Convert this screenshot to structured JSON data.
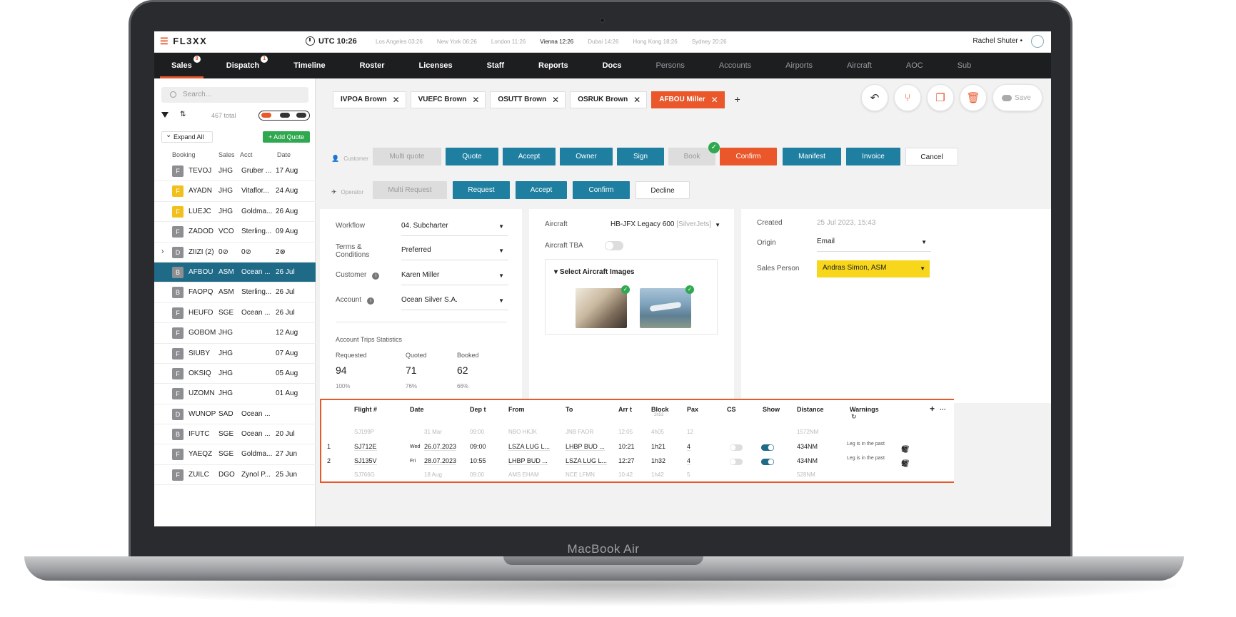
{
  "device": {
    "brand": "MacBook Air"
  },
  "topbar": {
    "logo": "FL3XX",
    "utc": "UTC 10:26",
    "cities": [
      "Los Angeles 03:26",
      "New York 06:26",
      "London 11:26",
      "Vienna 12:26",
      "Dubai 14:26",
      "Hong Kong 18:26",
      "Sydney 20:26"
    ],
    "active_city_index": 3,
    "user": "Rachel Shuter •"
  },
  "nav": {
    "items": [
      {
        "label": "Sales",
        "badge": "8",
        "active": true,
        "dim": false
      },
      {
        "label": "Dispatch",
        "badge": "1",
        "active": false,
        "dim": false
      },
      {
        "label": "Timeline",
        "badge": "",
        "active": false,
        "dim": false
      },
      {
        "label": "Roster",
        "badge": "",
        "active": false,
        "dim": false
      },
      {
        "label": "Licenses",
        "badge": "",
        "active": false,
        "dim": false
      },
      {
        "label": "Staff",
        "badge": "",
        "active": false,
        "dim": false
      },
      {
        "label": "Reports",
        "badge": "",
        "active": false,
        "dim": false
      },
      {
        "label": "Docs",
        "badge": "",
        "active": false,
        "dim": false
      },
      {
        "label": "Persons",
        "badge": "",
        "active": false,
        "dim": true
      },
      {
        "label": "Accounts",
        "badge": "",
        "active": false,
        "dim": true
      },
      {
        "label": "Airports",
        "badge": "",
        "active": false,
        "dim": true
      },
      {
        "label": "Aircraft",
        "badge": "",
        "active": false,
        "dim": true
      },
      {
        "label": "AOC",
        "badge": "",
        "active": false,
        "dim": true
      },
      {
        "label": "Sub",
        "badge": "",
        "active": false,
        "dim": true
      }
    ]
  },
  "sidebar": {
    "search_placeholder": "Search...",
    "total": "467 total",
    "expand_all": "Expand All",
    "add_quote": "+ Add Quote",
    "columns": [
      "Booking",
      "Sales",
      "Acct",
      "Date"
    ],
    "rows": [
      {
        "status": "F",
        "booking": "TEVOJ",
        "sales": "JHG",
        "acct": "Gruber ...",
        "date": "17 Aug",
        "yellow": false,
        "selected": false
      },
      {
        "status": "F",
        "booking": "AYADN",
        "sales": "JHG",
        "acct": "Vitaflor...",
        "date": "24 Aug",
        "yellow": true,
        "selected": false
      },
      {
        "status": "F",
        "booking": "LUEJC",
        "sales": "JHG",
        "acct": "Goldma...",
        "date": "26 Aug",
        "yellow": true,
        "selected": false
      },
      {
        "status": "F",
        "booking": "ZADOD",
        "sales": "VCO",
        "acct": "Sterling...",
        "date": "09 Aug",
        "yellow": false,
        "selected": false
      },
      {
        "status": "D",
        "booking": "ZIIZI (2)",
        "sales": "0⊘",
        "acct": "0⊘",
        "date": "2⊗",
        "yellow": false,
        "selected": false,
        "group": true
      },
      {
        "status": "B",
        "booking": "AFBOU",
        "sales": "ASM",
        "acct": "Ocean ...",
        "date": "26 Jul",
        "yellow": false,
        "selected": true
      },
      {
        "status": "B",
        "booking": "FAOPQ",
        "sales": "ASM",
        "acct": "Sterling...",
        "date": "26 Jul",
        "yellow": false,
        "selected": false
      },
      {
        "status": "F",
        "booking": "HEUFD",
        "sales": "SGE",
        "acct": "Ocean ...",
        "date": "26 Jul",
        "yellow": false,
        "selected": false
      },
      {
        "status": "F",
        "booking": "GOBOM",
        "sales": "JHG",
        "acct": "",
        "date": "12 Aug",
        "yellow": false,
        "selected": false
      },
      {
        "status": "F",
        "booking": "SIUBY",
        "sales": "JHG",
        "acct": "",
        "date": "07 Aug",
        "yellow": false,
        "selected": false
      },
      {
        "status": "F",
        "booking": "OKSIQ",
        "sales": "JHG",
        "acct": "",
        "date": "05 Aug",
        "yellow": false,
        "selected": false
      },
      {
        "status": "F",
        "booking": "UZOMN",
        "sales": "JHG",
        "acct": "",
        "date": "01 Aug",
        "yellow": false,
        "selected": false
      },
      {
        "status": "D",
        "booking": "WUNOP",
        "sales": "SAD",
        "acct": "Ocean ...",
        "date": "",
        "yellow": false,
        "selected": false
      },
      {
        "status": "B",
        "booking": "IFUTC",
        "sales": "SGE",
        "acct": "Ocean ...",
        "date": "20 Jul",
        "yellow": false,
        "selected": false
      },
      {
        "status": "F",
        "booking": "YAEQZ",
        "sales": "SGE",
        "acct": "Goldma...",
        "date": "27 Jun",
        "yellow": false,
        "selected": false
      },
      {
        "status": "F",
        "booking": "ZUILC",
        "sales": "DGO",
        "acct": "Zynol P...",
        "date": "25 Jun",
        "yellow": false,
        "selected": false
      }
    ]
  },
  "tabs": [
    {
      "label": "IVPOA Brown",
      "active": false
    },
    {
      "label": "VUEFC Brown",
      "active": false
    },
    {
      "label": "OSUTT Brown",
      "active": false
    },
    {
      "label": "OSRUK Brown",
      "active": false
    },
    {
      "label": "AFBOU Miller",
      "active": true
    }
  ],
  "actions": {
    "save": "Save"
  },
  "customer_row": {
    "label": "Customer",
    "buttons": [
      "Multi quote",
      "Quote",
      "Accept",
      "Owner",
      "Sign",
      "Book",
      "Confirm",
      "Manifest",
      "Invoice",
      "Cancel"
    ]
  },
  "operator_row": {
    "label": "Operator",
    "buttons": [
      "Multi Request",
      "Request",
      "Accept",
      "Confirm",
      "Decline"
    ]
  },
  "details": {
    "workflow_label": "Workflow",
    "workflow": "04. Subcharter",
    "terms_label": "Terms & Conditions",
    "terms": "Preferred",
    "customer_label": "Customer",
    "customer": "Karen Miller",
    "account_label": "Account",
    "account": "Ocean Silver S.A.",
    "stats_title": "Account Trips Statistics",
    "stats": [
      {
        "label": "Requested",
        "value": "94",
        "pct": "100%"
      },
      {
        "label": "Quoted",
        "value": "71",
        "pct": "76%"
      },
      {
        "label": "Booked",
        "value": "62",
        "pct": "66%"
      }
    ]
  },
  "aircraft": {
    "label": "Aircraft",
    "value": "HB-JFX Legacy 600",
    "operator": "[SilverJets]",
    "tba_label": "Aircraft TBA",
    "images_title": "Select Aircraft Images"
  },
  "meta": {
    "created_label": "Created",
    "created": "25 Jul 2023, 15:43",
    "origin_label": "Origin",
    "origin": "Email",
    "sales_label": "Sales Person",
    "sales": "Andras Simon, ASM"
  },
  "flights": {
    "headers": [
      "Flight #",
      "Date",
      "Dep t",
      "From",
      "To",
      "Arr t",
      "Block",
      "Pax",
      "CS",
      "Show",
      "Distance",
      "Warnings"
    ],
    "block_sub": "2h53",
    "rows": [
      {
        "n": "",
        "flight": "SJ199P",
        "dow": "",
        "date": "31 Mar",
        "dep": "09:00",
        "from": "NBO HKJK",
        "to": "JNB FAOR",
        "arr": "12:05",
        "block": "4h05",
        "pax": "12",
        "dist": "1572NM",
        "warn": "",
        "ghost": true
      },
      {
        "n": "1",
        "flight": "SJ712E",
        "dow": "Wed",
        "date": "26.07.2023",
        "dep": "09:00",
        "from": "LSZA LUG L...",
        "to": "LHBP BUD ...",
        "arr": "10:21",
        "block": "1h21",
        "pax": "4",
        "dist": "434NM",
        "warn": "Leg is in the past",
        "ghost": false
      },
      {
        "n": "2",
        "flight": "SJ135V",
        "dow": "Fri",
        "date": "28.07.2023",
        "dep": "10:55",
        "from": "LHBP BUD ...",
        "to": "LSZA LUG L...",
        "arr": "12:27",
        "block": "1h32",
        "pax": "4",
        "dist": "434NM",
        "warn": "Leg is in the past",
        "ghost": false
      },
      {
        "n": "",
        "flight": "SJ766G",
        "dow": "",
        "date": "18 Aug",
        "dep": "09:00",
        "from": "AMS EHAM",
        "to": "NCE LFMN",
        "arr": "10:42",
        "block": "1h42",
        "pax": "5",
        "dist": "528NM",
        "warn": "",
        "ghost": true
      }
    ]
  },
  "colors": {
    "accent": "#e9572b",
    "primary": "#1f7fa0",
    "selected": "#1f6b87",
    "dark_nav": "#1d1e20",
    "yellow": "#f2c01c",
    "green": "#2fa84f"
  }
}
